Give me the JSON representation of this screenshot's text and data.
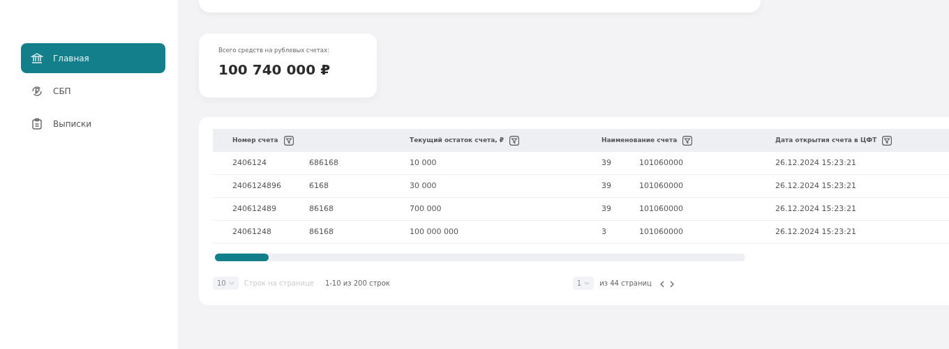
{
  "sidebar": {
    "items": [
      {
        "label": "Главная",
        "selected": true
      },
      {
        "label": "СБП",
        "selected": false
      },
      {
        "label": "Выписки",
        "selected": false
      }
    ]
  },
  "balance": {
    "label": "Всего средств на рублевых счетах:",
    "amount": "100 740 000 ₽"
  },
  "table": {
    "columns": [
      "Номер счета",
      "Текущий остаток счета, ₽",
      "Наименование счета",
      "Дата открытия  счета в ЦФТ"
    ],
    "rows": [
      [
        [
          "2406124",
          "686168"
        ],
        [
          "10 000"
        ],
        [
          "39",
          "101060000"
        ],
        [
          "26.12.2024 15:23:21"
        ]
      ],
      [
        [
          "2406124896",
          "6168"
        ],
        [
          "30 000"
        ],
        [
          "39",
          "101060000"
        ],
        [
          "26.12.2024 15:23:21"
        ]
      ],
      [
        [
          "240612489",
          "86168"
        ],
        [
          "700 000"
        ],
        [
          "39",
          "101060000"
        ],
        [
          "26.12.2024 15:23:21"
        ]
      ],
      [
        [
          "24061248",
          "86168"
        ],
        [
          "100 000 000"
        ],
        [
          "3",
          "101060000"
        ],
        [
          "26.12.2024 15:23:21"
        ]
      ]
    ]
  },
  "pagination": {
    "page_size": "10",
    "page_size_label": "Строк на странице",
    "range": "1-10 из 200 строк",
    "page": "1",
    "pages": "из 44 страниц"
  }
}
